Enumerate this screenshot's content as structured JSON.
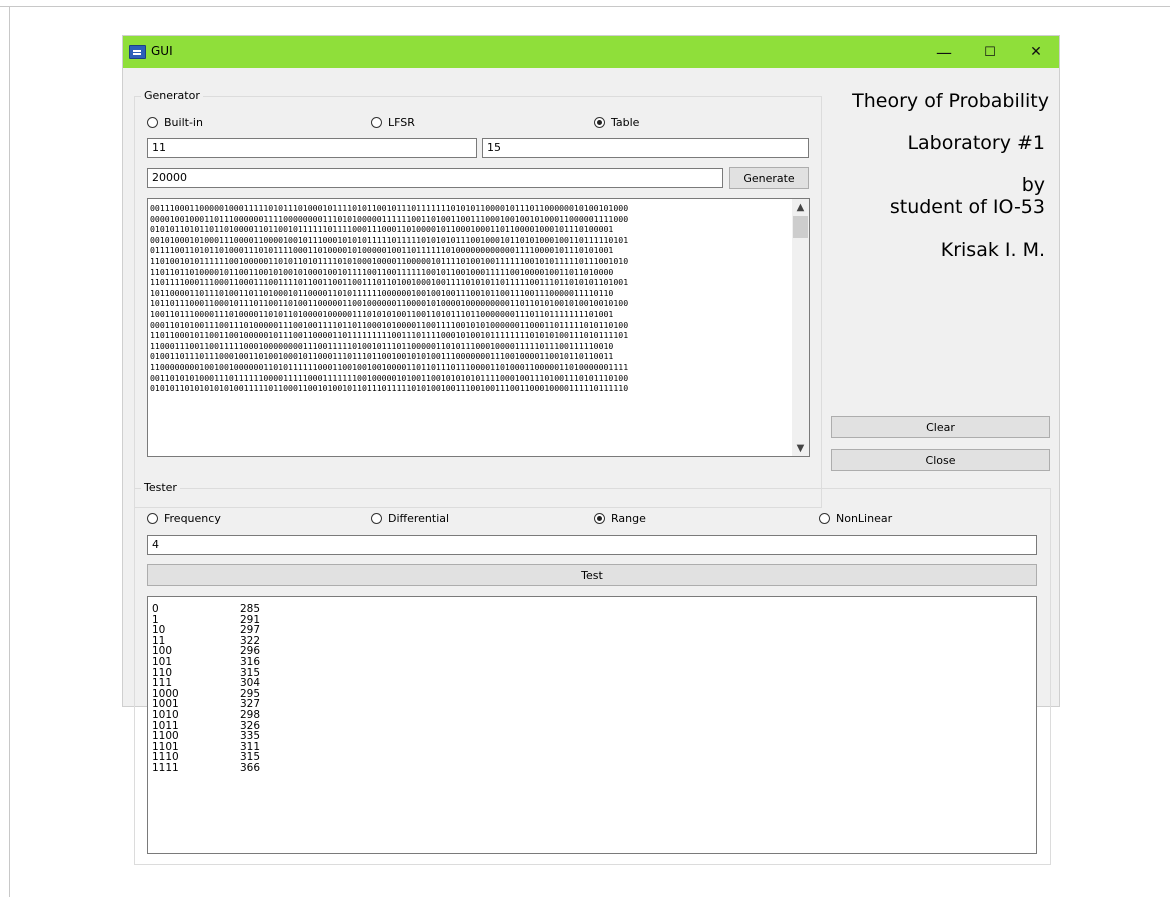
{
  "window": {
    "title": "GUI",
    "controls": {
      "minimize": "—",
      "maximize": "☐",
      "close": "✕"
    }
  },
  "generator": {
    "legend": "Generator",
    "radios": [
      {
        "label": "Built-in",
        "checked": false
      },
      {
        "label": "LFSR",
        "checked": false
      },
      {
        "label": "Table",
        "checked": true
      }
    ],
    "param1": "11",
    "param2": "15",
    "count": "20000",
    "generate_label": "Generate",
    "output_lines": [
      "0011100011000001000111110101110100010111101011001011101111111010101100001011101100000010100101000",
      "0000100100011011100000011110000000011101010000011111100110100110011100010010010100011000001111000",
      "0101011010110110100001101100101111110111100011100011010000101100010001101100001000101110100001",
      "0010100010100011100001100001001011100010101011111011111010101011100100010110101000100110111110101",
      "0111100110101101000111010111100011010000101000001001101111110100000000000011110000101110101001",
      "1101001010111111001000001101011010111101010001000011000001011110100100111111001010111110111001010",
      "1101101101000010110011001010010100010010111100110011111100101100100011111001000010011011010000",
      "1101111000111000110001110011110110011001100111011010010001001111010101101111100111011010101101001",
      "1011000011011101001101101000101100001101011111100000010010010011100101100111001110000011110110",
      "1011011100011000101110110011010011000001100100000011000010100001000000000110110101001010010010100",
      "1001101110000111010000110101101000010000011101010100110011010111011000000011101101111111101001",
      "0001101010011100111010000011100100111101101100010100001100111100101010000001100011011111010110100",
      "1101100010110011001000001011100110000110111111111001110111100010100101111111101010100111010111101",
      "1100011100110011111000100000000111001111101001011101100000110101110001000011111011100111110010",
      "0100110111011100010011010010001011000111011101100100101010011100000001110010000110010110110011",
      "1100000000100100100000011010111111000110010010010000110110111011100001101000110000011010000001111",
      "0011010101000111011111100001111100011111110010000010100110010101010111100010011101001110101110100",
      "0101011010101010100111110110001100101001011011101111101010010011100100111001100010000111110111110"
    ],
    "scroll_up": "▲",
    "scroll_down": "▼"
  },
  "credits": {
    "line1": "Theory of Probability",
    "line2": "Laboratory #1",
    "line3": "by",
    "line4": "student of IO-53",
    "line5": "Krisak I. M."
  },
  "side_buttons": {
    "clear_label": "Clear",
    "close_label": "Close"
  },
  "tester": {
    "legend": "Tester",
    "radios": [
      {
        "label": "Frequency",
        "checked": false
      },
      {
        "label": "Differential",
        "checked": false
      },
      {
        "label": "Range",
        "checked": true
      },
      {
        "label": "NonLinear",
        "checked": false
      }
    ],
    "input": "4",
    "test_label": "Test",
    "results": [
      {
        "key": "0",
        "value": "285"
      },
      {
        "key": "1",
        "value": "291"
      },
      {
        "key": "10",
        "value": "297"
      },
      {
        "key": "11",
        "value": "322"
      },
      {
        "key": "100",
        "value": "296"
      },
      {
        "key": "101",
        "value": "316"
      },
      {
        "key": "110",
        "value": "315"
      },
      {
        "key": "111",
        "value": "304"
      },
      {
        "key": "1000",
        "value": "295"
      },
      {
        "key": "1001",
        "value": "327"
      },
      {
        "key": "1010",
        "value": "298"
      },
      {
        "key": "1011",
        "value": "326"
      },
      {
        "key": "1100",
        "value": "335"
      },
      {
        "key": "1101",
        "value": "311"
      },
      {
        "key": "1110",
        "value": "315"
      },
      {
        "key": "1111",
        "value": "366"
      }
    ]
  }
}
